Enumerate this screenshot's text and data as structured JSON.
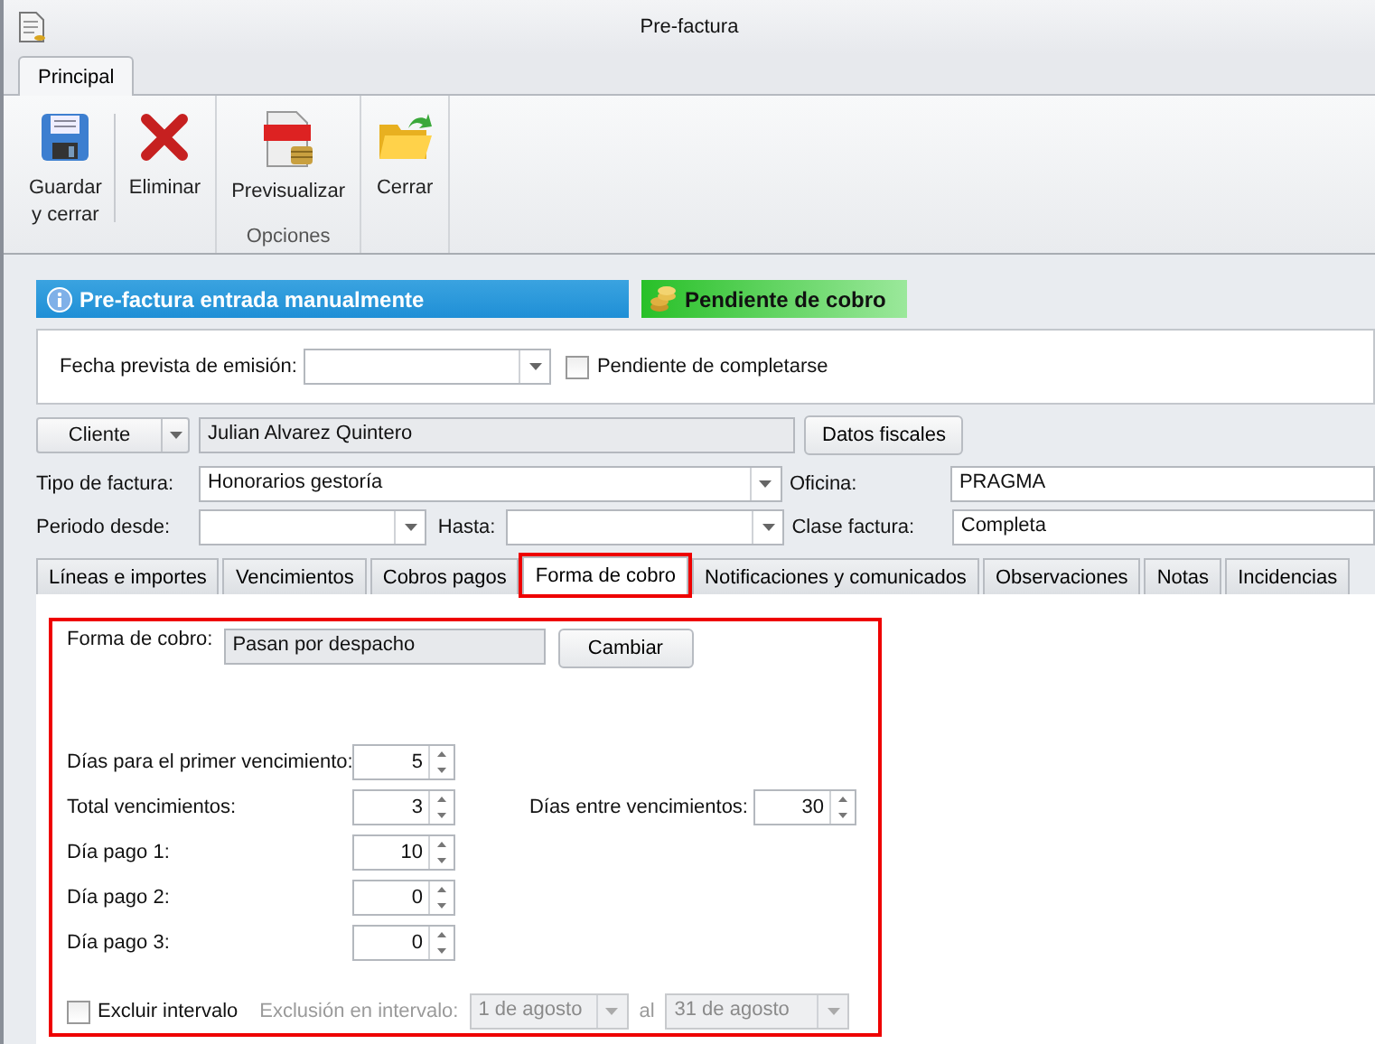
{
  "window": {
    "title": "Pre-factura"
  },
  "ribbon": {
    "tabs": [
      {
        "label": "Principal",
        "selected": true
      }
    ],
    "groups": [
      {
        "buttons": [
          "Guardar\ny cerrar",
          "Eliminar"
        ]
      },
      {
        "buttons": [
          "Previsualizar"
        ],
        "label": "Opciones"
      },
      {
        "buttons": [
          "Cerrar"
        ]
      }
    ]
  },
  "banners": [
    {
      "kind": "info",
      "text": "Pre-factura entrada manualmente"
    },
    {
      "kind": "status",
      "text": "Pendiente de cobro"
    }
  ],
  "header": {
    "fecha_label": "Fecha prevista de emisión:",
    "pendiente": {
      "label": "Pendiente de completarse",
      "checked": false
    }
  },
  "cliente": {
    "button": "Cliente",
    "name": "Julian Alvarez Quintero",
    "datos_button": "Datos fiscales"
  },
  "tipo": {
    "label": "Tipo de factura:",
    "value": "Honorarios gestoría"
  },
  "oficina": {
    "label": "Oficina:",
    "value": "PRAGMA"
  },
  "periodo": {
    "desde_label": "Periodo desde:",
    "hasta_label": "Hasta:"
  },
  "clase": {
    "label": "Clase factura:",
    "value": "Completa"
  },
  "tabs": [
    {
      "label": "Líneas e importes",
      "selected": false,
      "highlighted": false
    },
    {
      "label": "Vencimientos",
      "selected": false,
      "highlighted": false
    },
    {
      "label": "Cobros pagos",
      "selected": false,
      "highlighted": false
    },
    {
      "label": "Forma de cobro",
      "selected": true,
      "highlighted": true
    },
    {
      "label": "Notificaciones y comunicados",
      "selected": false,
      "highlighted": false
    },
    {
      "label": "Observaciones",
      "selected": false,
      "highlighted": false
    },
    {
      "label": "Notas",
      "selected": false,
      "highlighted": false
    },
    {
      "label": "Incidencias",
      "selected": false,
      "highlighted": false
    }
  ],
  "panel": {
    "highlighted": true,
    "forma_label": "Forma de cobro:",
    "forma_value": "Pasan por despacho",
    "cambiar_button": "Cambiar",
    "spinners": [
      {
        "label": "Días para el primer vencimiento:",
        "value": "5"
      },
      {
        "label": "Total vencimientos:",
        "value": "3"
      },
      {
        "label": "Día pago 1:",
        "value": "10"
      },
      {
        "label": "Día pago 2:",
        "value": "0"
      },
      {
        "label": "Día pago 3:",
        "value": "0"
      }
    ],
    "entre": {
      "label": "Días entre vencimientos:",
      "value": "30"
    },
    "exclusion": {
      "checkbox": {
        "label": "Excluir intervalo",
        "checked": false
      },
      "disabled": true,
      "label": "Exclusión en intervalo:",
      "from": "1 de agosto",
      "al": "al",
      "to": "31 de agosto"
    }
  }
}
